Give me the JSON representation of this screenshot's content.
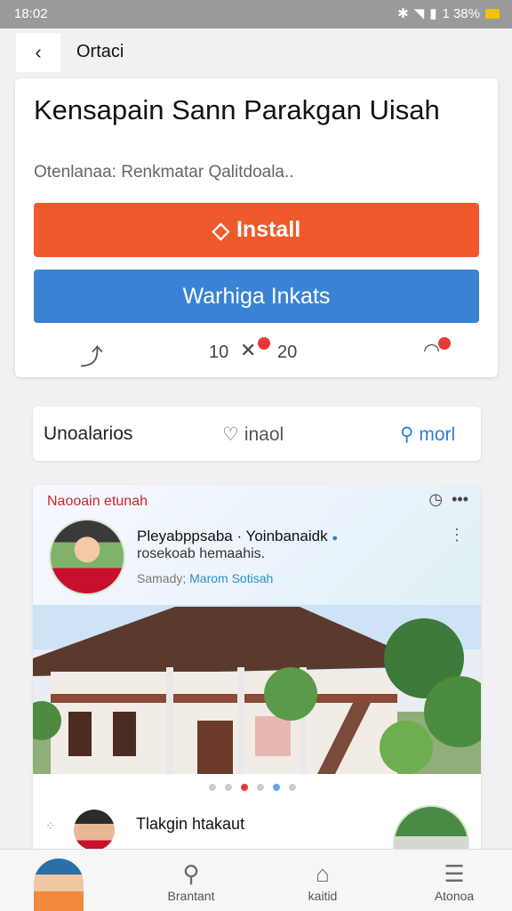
{
  "status": {
    "time": "18:02",
    "battery_text": "1 38%",
    "battery_color": "#f2c300"
  },
  "nav": {
    "back_icon": "back-arrow-icon",
    "title": "Ortaci"
  },
  "app": {
    "title": "Kensapain Sann Parakgan Uisah",
    "subtitle": "Otenlanaa: Renkmatar Qalitdoala..",
    "install_label": "Install",
    "secondary_label": "Warhiga Inkats",
    "stat_a": "10",
    "stat_b": "20",
    "accent_install": "#ef5a2c",
    "accent_secondary": "#3a83d4"
  },
  "filters": {
    "left": "Unoalarios",
    "middle": "inaol",
    "right": "morl"
  },
  "post": {
    "category": "Naooain etunah",
    "author": "Pleyabppsaba · Yoinbanaidk",
    "description": "rosekoab hemaahis.",
    "meta_prefix": "Samady;",
    "meta_link": "Marom Sotisah"
  },
  "post2": {
    "title": "Tlakgin htakaut"
  },
  "bottom_nav": {
    "items": [
      {
        "label": "Brantant",
        "icon": "search-icon"
      },
      {
        "label": "kaitid",
        "icon": "home-icon"
      },
      {
        "label": "Atonoa",
        "icon": "document-icon"
      }
    ]
  }
}
